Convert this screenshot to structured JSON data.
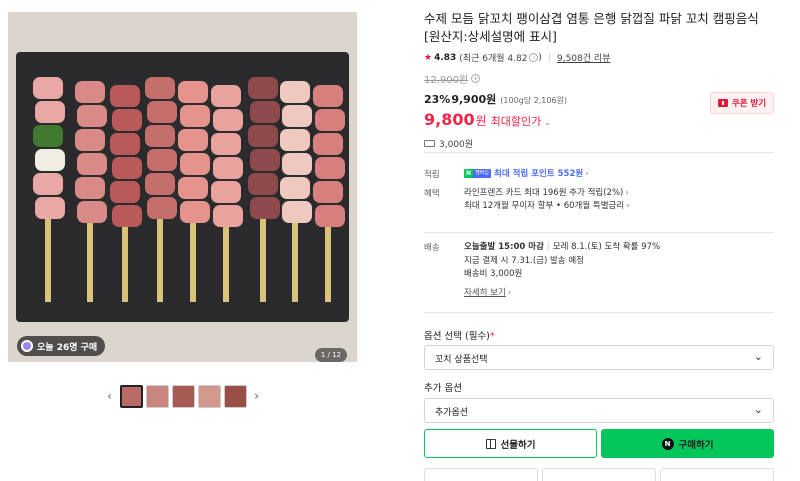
{
  "gallery": {
    "buyer_badge": "오늘 26명 구매",
    "counter": "1 / 12",
    "thumbnails": [
      {
        "name": "thumb-1",
        "color": "#b86b66",
        "active": true
      },
      {
        "name": "thumb-2",
        "color": "#c9867f",
        "active": false
      },
      {
        "name": "thumb-3",
        "color": "#a55b53",
        "active": false
      },
      {
        "name": "thumb-4",
        "color": "#d4978c",
        "active": false
      },
      {
        "name": "thumb-5",
        "color": "#9a4e46",
        "active": false
      }
    ],
    "prev_icon": "chevron-left-icon",
    "next_icon": "chevron-right-icon"
  },
  "product": {
    "title": "수제 모듬 닭꼬치 팽이삼겹 염통 은행 닭껍질 파닭 꼬치 캠핑음식 [원산지:상세설명에 표시]",
    "rating": "4.83",
    "recent_rating": "(최근 6개월 4.82",
    "review_count": "9,508건 리뷰",
    "original_price": "12,900원",
    "discount_rate": "23%",
    "discount_price": "9,900원",
    "unit_price": "(100g당 2,106원)",
    "final_price": "9,800",
    "final_won": "원",
    "max_discount_label": "최대할인가",
    "coupon_label": "쿠폰 받기",
    "shipping_fee": "3,000원"
  },
  "benefits": {
    "point_key": "적립",
    "npay_n": "N",
    "npay_text": "멤버십",
    "point_value": "최대 적립 포인트 552원",
    "benefit_key": "혜택",
    "benefit_line1": "라인프렌즈 카드 최대 196원 추가 적립(2%)",
    "benefit_line2": "최대 12개월 무이자 할부 • 60개월 특별금리"
  },
  "delivery": {
    "key": "배송",
    "dispatch_bold": "오늘출발 15:00 마감",
    "dispatch_rest": "모레 8.1.(토) 도착 확률 97%",
    "line2": "지금 결제 시 7.31.(금) 발송 예정",
    "line3": "배송비 3,000원",
    "detail_link": "자세히 보기"
  },
  "options": {
    "required_label": "옵션 선택 (필수)",
    "required_mark": "*",
    "required_value": "꼬치 상품선택",
    "extra_label": "추가 옵션",
    "extra_value": "추가옵션"
  },
  "actions": {
    "gift_label": "선물하기",
    "buy_label": "구매하기",
    "buy_badge": "N"
  },
  "colors": {
    "accent_red": "#f02649",
    "naver_green": "#03c75a",
    "point_blue": "#4b6bfb"
  }
}
